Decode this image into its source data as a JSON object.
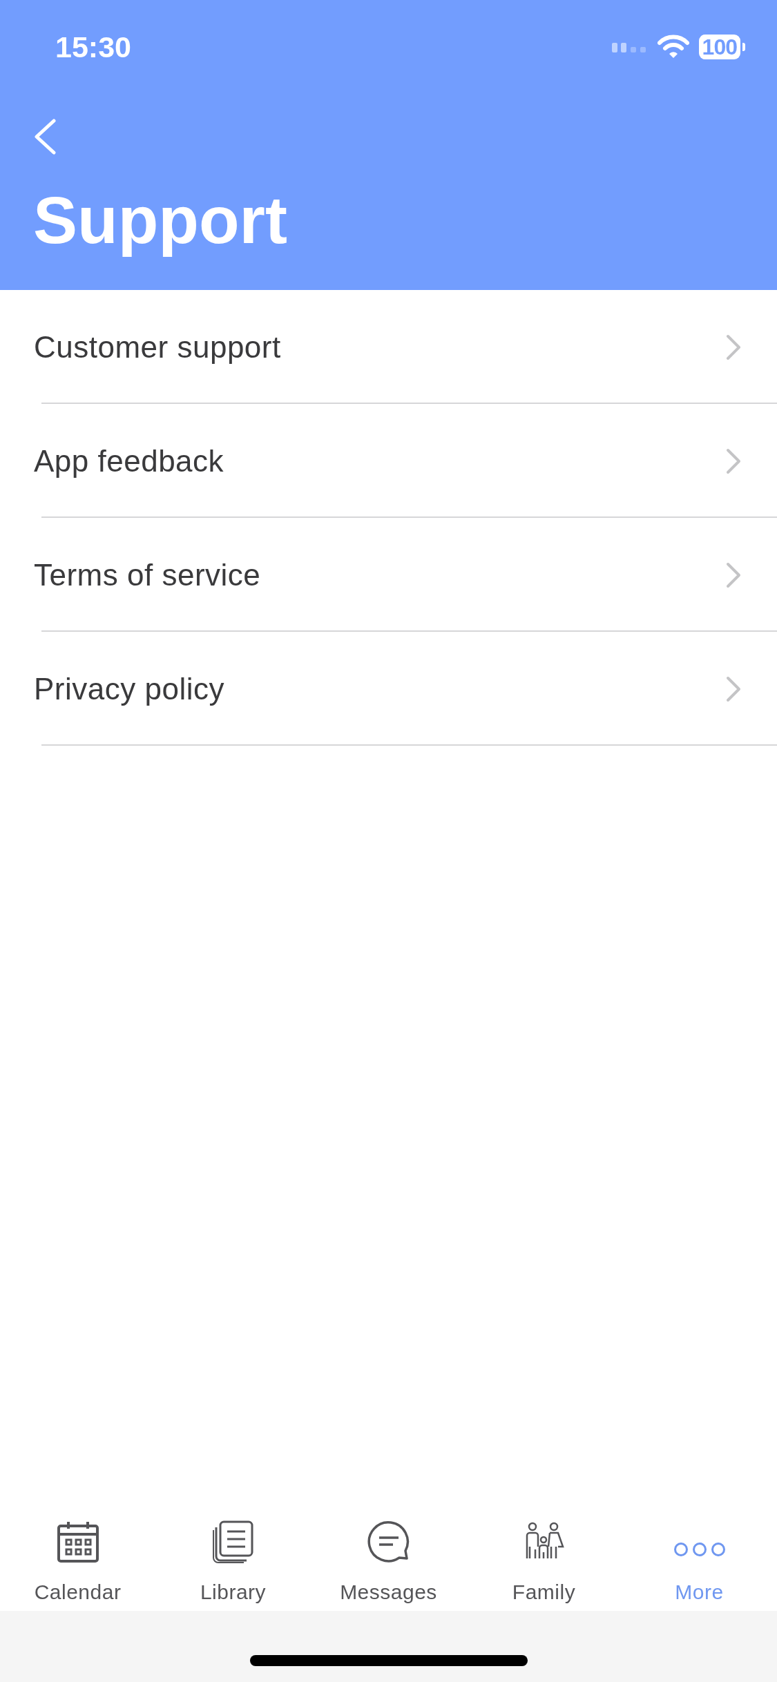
{
  "status_bar": {
    "time": "15:30",
    "battery": "100"
  },
  "header": {
    "title": "Support"
  },
  "menu": [
    {
      "label": "Customer support"
    },
    {
      "label": "App feedback"
    },
    {
      "label": "Terms of service"
    },
    {
      "label": "Privacy policy"
    }
  ],
  "tab_bar": [
    {
      "label": "Calendar",
      "kind": "calendar",
      "selected": false
    },
    {
      "label": "Library",
      "kind": "library",
      "selected": false
    },
    {
      "label": "Messages",
      "kind": "messages",
      "selected": false
    },
    {
      "label": "Family",
      "kind": "family",
      "selected": false
    },
    {
      "label": "More",
      "kind": "more",
      "selected": true
    }
  ]
}
